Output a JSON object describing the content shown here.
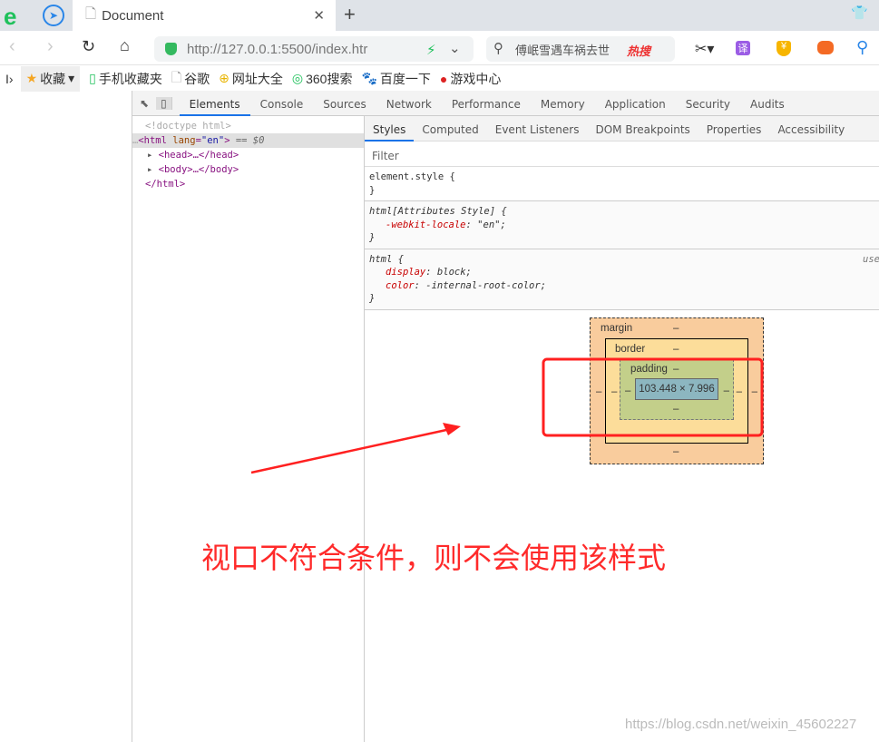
{
  "browser": {
    "tab_title": "Document",
    "url": "http://127.0.0.1:5500/index.htr",
    "search_text": "傅岷雪遇车祸去世",
    "hot_label": "热搜"
  },
  "bookmarks": [
    "收藏",
    "手机收藏夹",
    "谷歌",
    "网址大全",
    "360搜索",
    "百度一下",
    "游戏中心"
  ],
  "devtools": {
    "tabs": [
      "Elements",
      "Console",
      "Sources",
      "Network",
      "Performance",
      "Memory",
      "Application",
      "Security",
      "Audits"
    ],
    "subtabs": [
      "Styles",
      "Computed",
      "Event Listeners",
      "DOM Breakpoints",
      "Properties",
      "Accessibility"
    ],
    "filter_placeholder": "Filter",
    "dom": {
      "doctype": "<!doctype html>",
      "html_open": "<html",
      "lang_attr": "lang",
      "lang_val": "\"en\"",
      "html_close_bracket": ">",
      "sel_marker": " == $0",
      "head": "<head>…</head>",
      "body": "<body>…</body>",
      "html_end": "</html>"
    },
    "rules": [
      {
        "selector": "element.style {",
        "close": "}"
      },
      {
        "selector": "html[Attributes Style] {",
        "props": [
          [
            "-webkit-locale",
            "\"en\";"
          ]
        ],
        "close": "}"
      },
      {
        "selector": "html {",
        "source": "use",
        "props": [
          [
            "display",
            "block;"
          ],
          [
            "color",
            "-internal-root-color;"
          ]
        ],
        "close": "}"
      }
    ],
    "box_model": {
      "margin": "margin",
      "border": "border",
      "padding": "padding",
      "content": "103.448 × 7.996",
      "dash": "–"
    }
  },
  "annotation": "视口不符合条件，则不会使用该样式",
  "watermark": "https://blog.csdn.net/weixin_45602227",
  "colors": {
    "accent": "#1a73e8",
    "annotation": "#ff2a2a",
    "margin": "#f9cc9d",
    "border": "#fcdd9a",
    "padding": "#c3cf8a",
    "content": "#8cb6c0"
  }
}
